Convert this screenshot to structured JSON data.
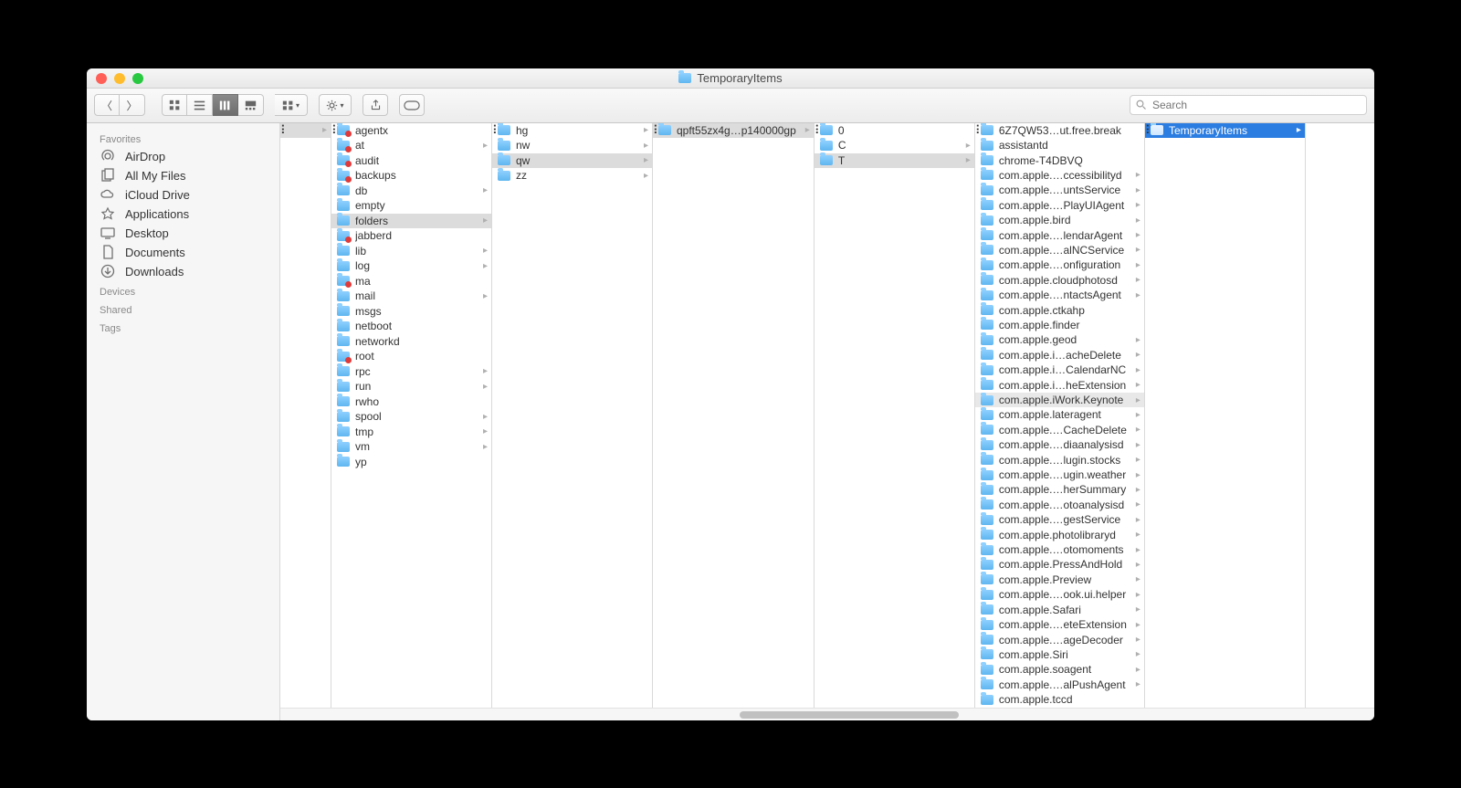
{
  "window": {
    "title": "TemporaryItems"
  },
  "search": {
    "placeholder": "Search"
  },
  "sidebar": {
    "sections": [
      {
        "header": "Favorites",
        "items": [
          {
            "icon": "airdrop",
            "label": "AirDrop"
          },
          {
            "icon": "all-files",
            "label": "All My Files"
          },
          {
            "icon": "cloud",
            "label": "iCloud Drive"
          },
          {
            "icon": "apps",
            "label": "Applications"
          },
          {
            "icon": "desktop",
            "label": "Desktop"
          },
          {
            "icon": "documents",
            "label": "Documents"
          },
          {
            "icon": "downloads",
            "label": "Downloads"
          }
        ]
      },
      {
        "header": "Devices",
        "items": []
      },
      {
        "header": "Shared",
        "items": []
      },
      {
        "header": "Tags",
        "items": []
      }
    ]
  },
  "columns": [
    {
      "selected": 0,
      "items": [
        {
          "label": "",
          "chev": true
        }
      ]
    },
    {
      "selected": 6,
      "items": [
        {
          "label": "agentx",
          "restricted": true
        },
        {
          "label": "at",
          "restricted": true,
          "chev": true
        },
        {
          "label": "audit",
          "restricted": true
        },
        {
          "label": "backups",
          "restricted": true
        },
        {
          "label": "db",
          "chev": true
        },
        {
          "label": "empty"
        },
        {
          "label": "folders",
          "chev": true
        },
        {
          "label": "jabberd",
          "restricted": true
        },
        {
          "label": "lib",
          "chev": true
        },
        {
          "label": "log",
          "chev": true
        },
        {
          "label": "ma",
          "restricted": true
        },
        {
          "label": "mail",
          "chev": true
        },
        {
          "label": "msgs"
        },
        {
          "label": "netboot"
        },
        {
          "label": "networkd"
        },
        {
          "label": "root",
          "restricted": true
        },
        {
          "label": "rpc",
          "chev": true
        },
        {
          "label": "run",
          "chev": true
        },
        {
          "label": "rwho"
        },
        {
          "label": "spool",
          "chev": true
        },
        {
          "label": "tmp",
          "chev": true
        },
        {
          "label": "vm",
          "chev": true
        },
        {
          "label": "yp"
        }
      ]
    },
    {
      "selected": 2,
      "items": [
        {
          "label": "hg",
          "chev": true
        },
        {
          "label": "nw",
          "chev": true
        },
        {
          "label": "qw",
          "chev": true
        },
        {
          "label": "zz",
          "chev": true
        }
      ]
    },
    {
      "selected": 0,
      "items": [
        {
          "label": "qpft55zx4g…p140000gp",
          "chev": true
        }
      ]
    },
    {
      "selected": 2,
      "items": [
        {
          "label": "0"
        },
        {
          "label": "C",
          "chev": true
        },
        {
          "label": "T",
          "chev": true
        }
      ]
    },
    {
      "hover": 18,
      "items": [
        {
          "label": "6Z7QW53…ut.free.break"
        },
        {
          "label": "assistantd"
        },
        {
          "label": "chrome-T4DBVQ"
        },
        {
          "label": "com.apple.…ccessibilityd",
          "chev": true
        },
        {
          "label": "com.apple.…untsService",
          "chev": true
        },
        {
          "label": "com.apple.…PlayUIAgent",
          "chev": true
        },
        {
          "label": "com.apple.bird",
          "chev": true
        },
        {
          "label": "com.apple.…lendarAgent",
          "chev": true
        },
        {
          "label": "com.apple.…alNCService",
          "chev": true
        },
        {
          "label": "com.apple.…onfiguration",
          "chev": true
        },
        {
          "label": "com.apple.cloudphotosd",
          "chev": true
        },
        {
          "label": "com.apple.…ntactsAgent",
          "chev": true
        },
        {
          "label": "com.apple.ctkahp"
        },
        {
          "label": "com.apple.finder"
        },
        {
          "label": "com.apple.geod",
          "chev": true
        },
        {
          "label": "com.apple.i…acheDelete",
          "chev": true
        },
        {
          "label": "com.apple.i…CalendarNC",
          "chev": true
        },
        {
          "label": "com.apple.i…heExtension",
          "chev": true
        },
        {
          "label": "com.apple.iWork.Keynote",
          "chev": true
        },
        {
          "label": "com.apple.lateragent",
          "chev": true
        },
        {
          "label": "com.apple.…CacheDelete",
          "chev": true
        },
        {
          "label": "com.apple.…diaanalysisd",
          "chev": true
        },
        {
          "label": "com.apple.…lugin.stocks",
          "chev": true
        },
        {
          "label": "com.apple.…ugin.weather",
          "chev": true
        },
        {
          "label": "com.apple.…herSummary",
          "chev": true
        },
        {
          "label": "com.apple.…otoanalysisd",
          "chev": true
        },
        {
          "label": "com.apple.…gestService",
          "chev": true
        },
        {
          "label": "com.apple.photolibraryd",
          "chev": true
        },
        {
          "label": "com.apple.…otomoments",
          "chev": true
        },
        {
          "label": "com.apple.PressAndHold",
          "chev": true
        },
        {
          "label": "com.apple.Preview",
          "chev": true
        },
        {
          "label": "com.apple.…ook.ui.helper",
          "chev": true
        },
        {
          "label": "com.apple.Safari",
          "chev": true
        },
        {
          "label": "com.apple.…eteExtension",
          "chev": true
        },
        {
          "label": "com.apple.…ageDecoder",
          "chev": true
        },
        {
          "label": "com.apple.Siri",
          "chev": true
        },
        {
          "label": "com.apple.soagent",
          "chev": true
        },
        {
          "label": "com.apple.…alPushAgent",
          "chev": true
        },
        {
          "label": "com.apple.tccd"
        }
      ]
    },
    {
      "selectedActive": 0,
      "items": [
        {
          "label": "TemporaryItems",
          "chev": true
        }
      ]
    }
  ]
}
